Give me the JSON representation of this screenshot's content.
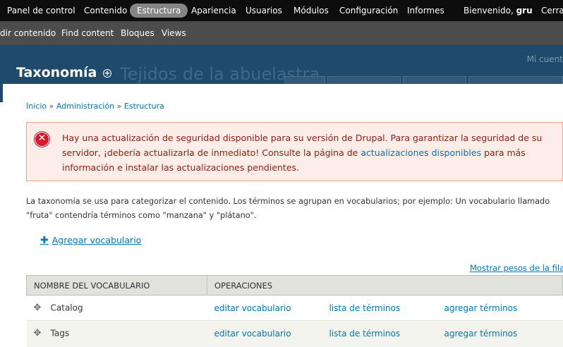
{
  "toolbar": {
    "items": [
      "Panel de control",
      "Contenido",
      "Estructura",
      "Apariencia",
      "Usuarios",
      "Módulos",
      "Configuración",
      "Informes"
    ],
    "welcome_prefix": "Bienvenido,",
    "user": "gru",
    "logout": "Cerra"
  },
  "shortcuts": {
    "items": [
      "dir contenido",
      "Find content",
      "Bloques",
      "Views"
    ]
  },
  "background": {
    "site_name": "Tejidos de la abuelastra",
    "account": "Mi cuent"
  },
  "overlay": {
    "title": "Taxonomía",
    "shortcut_icon": "add-shortcut-icon"
  },
  "breadcrumb": {
    "items": [
      "Inicio",
      "Administración",
      "Estructura"
    ],
    "separator": "»"
  },
  "message": {
    "icon": "error-icon",
    "text_before": "Hay una actualización de seguridad disponible para su versión de Drupal. Para garantizar la seguridad de su servidor, ¡debería actualizarla de inmediato! Consulte la página de ",
    "link": "actualizaciones disponibles",
    "text_after": " para más información e instalar las actualizaciones pendientes."
  },
  "description": "La taxonomía se usa para categorizar el contenido. Los términos se agrupan en vocabularios; por ejemplo: Un vocabulario llamado \"fruta\" contendría términos como \"manzana\" y \"plátano\".",
  "actions": {
    "add_vocabulary": "Agregar vocabulario",
    "show_weights": "Mostrar pesos de la fila"
  },
  "table": {
    "headers": [
      "NOMBRE DEL VOCABULARIO",
      "OPERACIONES"
    ],
    "rows": [
      {
        "name": "Catalog",
        "edit": "editar vocabulario",
        "list": "lista de términos",
        "add": "agregar términos"
      },
      {
        "name": "Tags",
        "edit": "editar vocabulario",
        "list": "lista de términos",
        "add": "agregar términos"
      }
    ]
  },
  "colors": {
    "link": "#0074bd",
    "toolbar_bg": "#0d0d0d",
    "shortcuts_bg": "#4c4c4c",
    "error_bg": "#fcede9",
    "error_text": "#8a1f11"
  }
}
